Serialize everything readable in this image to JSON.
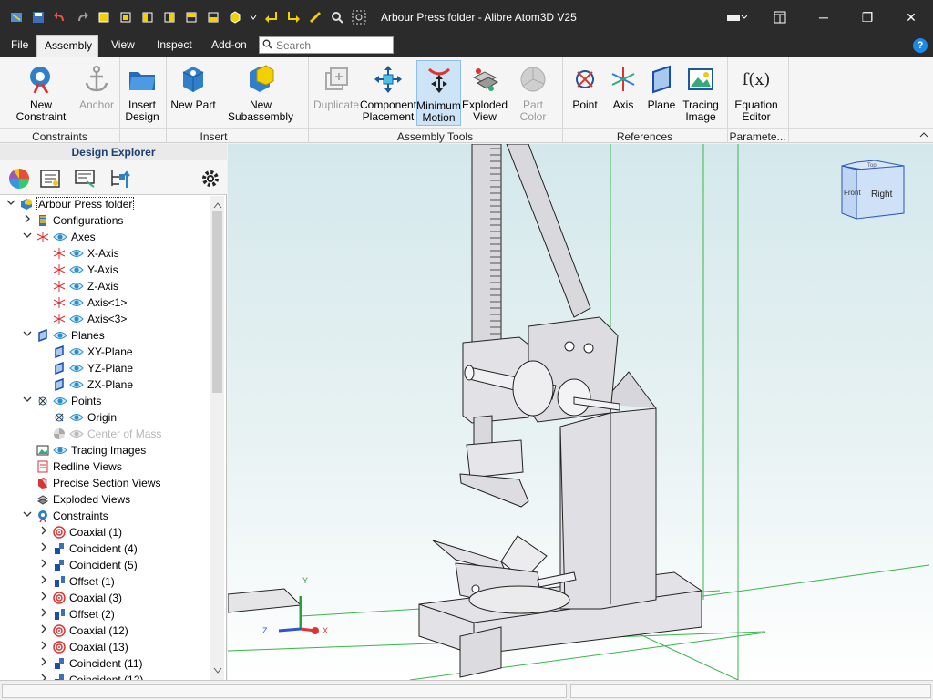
{
  "window": {
    "title": "Arbour Press folder - Alibre Atom3D V25",
    "controls": {
      "minimize": "─",
      "restore": "❐",
      "close": "✕"
    }
  },
  "menu": {
    "tabs": [
      "File",
      "Assembly",
      "View",
      "Inspect",
      "Add-on"
    ],
    "active_tab": "Assembly",
    "search_placeholder": "Search",
    "help": "?"
  },
  "ribbon": {
    "buttons": {
      "new_constraint": "New Constraint",
      "anchor": "Anchor",
      "insert_design": "Insert\nDesign",
      "new_part": "New Part",
      "new_subassembly": "New Subassembly",
      "duplicate": "Duplicate",
      "component_placement": "Component\nPlacement",
      "minimum_motion": "Minimum\nMotion",
      "exploded_view": "Exploded\nView",
      "part_color": "Part Color",
      "point": "Point",
      "axis": "Axis",
      "plane": "Plane",
      "tracing_image": "Tracing\nImage",
      "equation_editor": "Equation\nEditor"
    },
    "groups": [
      "Constraints",
      "Insert",
      "Assembly Tools",
      "References",
      "Paramete..."
    ],
    "equation_icon_text": "f(x)"
  },
  "explorer": {
    "title": "Design Explorer",
    "tree": [
      {
        "label": "Arbour Press folder",
        "depth": 0,
        "expand": "open",
        "icon": "assembly-icon",
        "eye": false
      },
      {
        "label": "Configurations",
        "depth": 1,
        "expand": "closed",
        "icon": "configurations-icon",
        "eye": false
      },
      {
        "label": "Axes",
        "depth": 1,
        "expand": "open",
        "icon": "axes-icon",
        "eye": true
      },
      {
        "label": "X-Axis",
        "depth": 2,
        "expand": "none",
        "icon": "axis-icon",
        "eye": true
      },
      {
        "label": "Y-Axis",
        "depth": 2,
        "expand": "none",
        "icon": "axis-icon",
        "eye": true
      },
      {
        "label": "Z-Axis",
        "depth": 2,
        "expand": "none",
        "icon": "axis-icon",
        "eye": true
      },
      {
        "label": "Axis<1>",
        "depth": 2,
        "expand": "none",
        "icon": "axis-icon",
        "eye": true
      },
      {
        "label": "Axis<3>",
        "depth": 2,
        "expand": "none",
        "icon": "axis-icon",
        "eye": true
      },
      {
        "label": "Planes",
        "depth": 1,
        "expand": "open",
        "icon": "planes-icon",
        "eye": true
      },
      {
        "label": "XY-Plane",
        "depth": 2,
        "expand": "none",
        "icon": "plane-icon",
        "eye": true
      },
      {
        "label": "YZ-Plane",
        "depth": 2,
        "expand": "none",
        "icon": "plane-icon",
        "eye": true
      },
      {
        "label": "ZX-Plane",
        "depth": 2,
        "expand": "none",
        "icon": "plane-icon",
        "eye": true
      },
      {
        "label": "Points",
        "depth": 1,
        "expand": "open",
        "icon": "points-icon",
        "eye": true
      },
      {
        "label": "Origin",
        "depth": 2,
        "expand": "none",
        "icon": "point-icon",
        "eye": true
      },
      {
        "label": "Center of Mass",
        "depth": 2,
        "expand": "none",
        "icon": "center-of-mass-icon",
        "eye": true,
        "dim": true
      },
      {
        "label": "Tracing Images",
        "depth": 1,
        "expand": "none",
        "icon": "tracing-image-icon",
        "eye": true
      },
      {
        "label": "Redline Views",
        "depth": 1,
        "expand": "none",
        "icon": "redline-icon",
        "eye": false
      },
      {
        "label": "Precise Section Views",
        "depth": 1,
        "expand": "none",
        "icon": "section-view-icon",
        "eye": false
      },
      {
        "label": "Exploded Views",
        "depth": 1,
        "expand": "none",
        "icon": "exploded-view-icon",
        "eye": false
      },
      {
        "label": "Constraints",
        "depth": 1,
        "expand": "open",
        "icon": "constraints-icon",
        "eye": false
      },
      {
        "label": "Coaxial (1)",
        "depth": 2,
        "expand": "closed",
        "icon": "coaxial-icon",
        "eye": false
      },
      {
        "label": "Coincident (4)",
        "depth": 2,
        "expand": "closed",
        "icon": "coincident-icon",
        "eye": false
      },
      {
        "label": "Coincident (5)",
        "depth": 2,
        "expand": "closed",
        "icon": "coincident-icon",
        "eye": false
      },
      {
        "label": "Offset (1)",
        "depth": 2,
        "expand": "closed",
        "icon": "offset-icon",
        "eye": false
      },
      {
        "label": "Coaxial (3)",
        "depth": 2,
        "expand": "closed",
        "icon": "coaxial-icon",
        "eye": false
      },
      {
        "label": "Offset (2)",
        "depth": 2,
        "expand": "closed",
        "icon": "offset-icon",
        "eye": false
      },
      {
        "label": "Coaxial (12)",
        "depth": 2,
        "expand": "closed",
        "icon": "coaxial-icon",
        "eye": false
      },
      {
        "label": "Coaxial (13)",
        "depth": 2,
        "expand": "closed",
        "icon": "coaxial-icon",
        "eye": false
      },
      {
        "label": "Coincident (11)",
        "depth": 2,
        "expand": "closed",
        "icon": "coincident-icon",
        "eye": false
      },
      {
        "label": "Coincident (12)",
        "depth": 2,
        "expand": "closed",
        "icon": "coincident-icon",
        "eye": false
      }
    ]
  },
  "viewport": {
    "view_cube": {
      "front": "Front",
      "right": "Right",
      "top": "Top"
    },
    "triad": {
      "x": "X",
      "y": "Y",
      "z": "Z"
    }
  },
  "colors": {
    "accent": "#1e88e5",
    "titlebar": "#2b2b2b",
    "grid_green": "#39b54a"
  }
}
